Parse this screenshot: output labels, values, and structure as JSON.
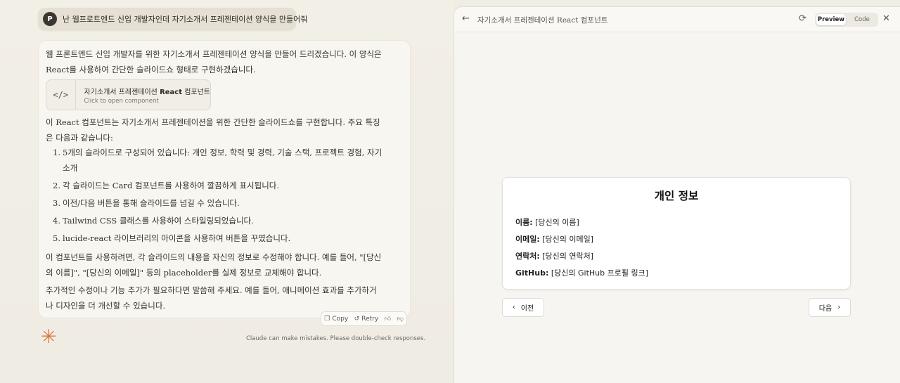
{
  "user_message": {
    "avatar": "P",
    "text": "난 웹프로트엔드 신입 개발자인데 자기소개서 프레젠테이션 양식을 만들어줘"
  },
  "assistant": {
    "intro": "웹 프론트엔드 신입 개발자를 위한 자기소개서 프레젠테이션 양식을 만들어 드리겠습니다. 이 양식은 React를 사용하여 간단한 슬라이드쇼 형태로 구현하겠습니다.",
    "artifact": {
      "icon": "</>",
      "title_prefix": "자기소개서 프레젠테이션 ",
      "title_bold": "React",
      "title_suffix": " 컴포넌트",
      "subtitle": "Click to open component"
    },
    "summary": "이 React 컴포넌트는 자기소개서 프레젠테이션을 위한 간단한 슬라이드쇼를 구현합니다. 주요 특징은 다음과 같습니다:",
    "features": [
      {
        "num": "1.",
        "text": "5개의 슬라이드로 구성되어 있습니다: 개인 정보, 학력 및 경력, 기술 스택, 프로젝트 경험, 자기 소개"
      },
      {
        "num": "2.",
        "text": "각 슬라이드는 Card 컴포넌트를 사용하여 깔끔하게 표시됩니다."
      },
      {
        "num": "3.",
        "text": "이전/다음 버튼을 통해 슬라이드를 넘길 수 있습니다."
      },
      {
        "num": "4.",
        "text": "Tailwind CSS 클래스를 사용하여 스타일링되었습니다."
      },
      {
        "num": "5.",
        "text": "lucide-react 라이브러리의 아이콘을 사용하여 버튼을 꾸몄습니다."
      }
    ],
    "usage": "이 컴포넌트를 사용하려면, 각 슬라이드의 내용을 자신의 정보로 수정해야 합니다. 예를 들어, \"[당신의 이름]\", \"[당신의 이메일]\" 등의 placeholder를 실제 정보로 교체해야 합니다.",
    "closing": "추가적인 수정이나 기능 추가가 필요하다면 말씀해 주세요. 예를 들어, 애니메이션 효과를 추가하거나 디자인을 더 개선할 수 있습니다.",
    "actions": {
      "copy": "Copy",
      "retry": "Retry"
    }
  },
  "disclaimer": "Claude can make mistakes. Please double-check responses.",
  "artifact_pane": {
    "title": "자기소개서 프레젠테이션 React 컴포넌트",
    "tabs": {
      "preview": "Preview",
      "code": "Code"
    },
    "active_tab": "Preview",
    "slide": {
      "title": "개인 정보",
      "fields": [
        {
          "label": "이름:",
          "value": " [당신의 이름]"
        },
        {
          "label": "이메일:",
          "value": " [당신의 이메일]"
        },
        {
          "label": "연락처:",
          "value": " [당신의 연락처]"
        },
        {
          "label": "GitHub:",
          "value": " [당신의 GitHub 프로필 링크]"
        }
      ]
    },
    "prev_label": "이전",
    "next_label": "다음"
  },
  "colors": {
    "accent": "#d9773f"
  }
}
